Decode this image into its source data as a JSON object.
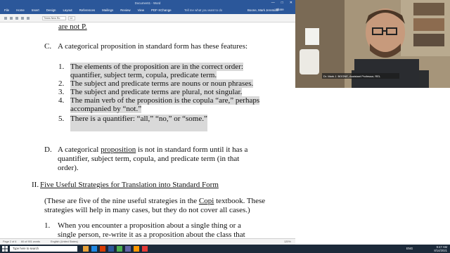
{
  "window": {
    "title": "Document1 - Word",
    "controls": [
      "—",
      "□",
      "✕"
    ],
    "tabs": [
      "File",
      "Home",
      "Insert",
      "Design",
      "Layout",
      "References",
      "Mailings",
      "Review",
      "View",
      "PDF-XChange"
    ],
    "tell_me": "Tell me what you want to do",
    "user": "Boone, Mark Jeremiah",
    "share": "Share"
  },
  "toolbar": {
    "font_name": "Times New Ro",
    "font_size": "14"
  },
  "document": {
    "line_top": "are not P.",
    "c_marker": "C.",
    "c_text": "A categorical proposition in standard form has these features:",
    "items": [
      {
        "num": "1.",
        "lines": [
          "The elements of the proposition are in the correct order:",
          "quantifier, subject term, copula, predicate term."
        ]
      },
      {
        "num": "2.",
        "lines": [
          "The subject and predicate terms are nouns or noun phrases."
        ]
      },
      {
        "num": "3.",
        "lines": [
          "The subject and predicate terms are plural, not singular."
        ]
      },
      {
        "num": "4.",
        "lines": [
          "The main verb of the proposition is the copula “are,” perhaps",
          "accompanied by “not.”"
        ]
      },
      {
        "num": "5.",
        "lines": [
          "There is a quantifier: “all,” “no,” or “some.”"
        ]
      }
    ],
    "d_marker": "D.",
    "d_pre": "A categorical ",
    "d_link": "proposition",
    "d_post": " is not in standard form until it has a",
    "d_line2": "quantifier, subject term, copula, and predicate term (in that",
    "d_line3": "order).",
    "ii_marker": "II.",
    "ii_heading": "Five Useful Strategies for Translation into Standard Form",
    "note_line1_pre": "(These are five of the nine useful strategies in the ",
    "note_link": "Copi",
    "note_line1_post": " textbook.  These",
    "note_line2": "strategies will help in many cases, but they do not cover all cases.)",
    "s1_num": "1.",
    "s1_line1": "When you encounter a proposition about a single thing or a",
    "s1_line2": "single person, re-write it as a proposition about the class that"
  },
  "status": {
    "page": "Page 2 of 4",
    "words": "60 of 901 words",
    "lang": "English (United States)",
    "zoom": "120%"
  },
  "webcam": {
    "caption": "Dr. Mark J. BOONE, Assistant Professor, REL"
  },
  "taskbar": {
    "search_placeholder": "Type here to search",
    "time": "9:47 AM",
    "date": "8/14/2021",
    "lang": "ENG"
  }
}
